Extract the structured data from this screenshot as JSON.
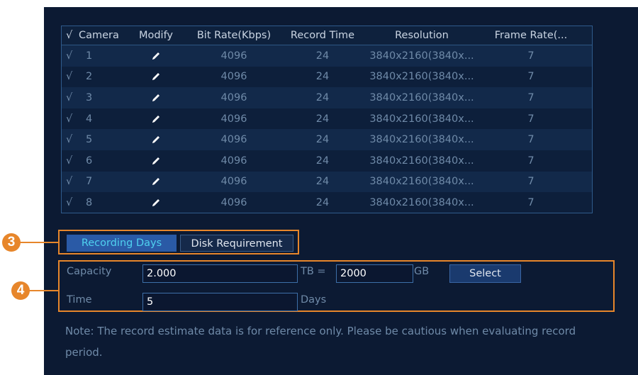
{
  "table": {
    "headers": {
      "check": "√",
      "camera": "Camera",
      "modify": "Modify",
      "bitrate": "Bit Rate(Kbps)",
      "record_time": "Record Time",
      "resolution": "Resolution",
      "frame_rate": "Frame Rate(..."
    },
    "rows": [
      {
        "check": "√",
        "camera": "1",
        "bitrate": "4096",
        "record_time": "24",
        "resolution": "3840x2160(3840x...",
        "frame_rate": "7"
      },
      {
        "check": "√",
        "camera": "2",
        "bitrate": "4096",
        "record_time": "24",
        "resolution": "3840x2160(3840x...",
        "frame_rate": "7"
      },
      {
        "check": "√",
        "camera": "3",
        "bitrate": "4096",
        "record_time": "24",
        "resolution": "3840x2160(3840x...",
        "frame_rate": "7"
      },
      {
        "check": "√",
        "camera": "4",
        "bitrate": "4096",
        "record_time": "24",
        "resolution": "3840x2160(3840x...",
        "frame_rate": "7"
      },
      {
        "check": "√",
        "camera": "5",
        "bitrate": "4096",
        "record_time": "24",
        "resolution": "3840x2160(3840x...",
        "frame_rate": "7"
      },
      {
        "check": "√",
        "camera": "6",
        "bitrate": "4096",
        "record_time": "24",
        "resolution": "3840x2160(3840x...",
        "frame_rate": "7"
      },
      {
        "check": "√",
        "camera": "7",
        "bitrate": "4096",
        "record_time": "24",
        "resolution": "3840x2160(3840x...",
        "frame_rate": "7"
      },
      {
        "check": "√",
        "camera": "8",
        "bitrate": "4096",
        "record_time": "24",
        "resolution": "3840x2160(3840x...",
        "frame_rate": "7"
      }
    ],
    "modify_icon": "pencil-icon"
  },
  "tabs": {
    "recording_days": "Recording Days",
    "disk_requirement": "Disk Requirement",
    "active": "recording_days"
  },
  "form": {
    "capacity_label": "Capacity",
    "capacity_value": "2.000",
    "tb_label": "TB =",
    "gb_value": "2000",
    "gb_label": "GB",
    "select_label": "Select",
    "time_label": "Time",
    "time_value": "5",
    "days_label": "Days"
  },
  "note": "Note: The record estimate data is for reference only. Please be cautious when evaluating record period.",
  "callouts": {
    "tabs": "3",
    "form": "4"
  },
  "colors": {
    "background": "#0c1a33",
    "accent": "#e7862b",
    "active_tab": "#2a5aa6",
    "active_tab_text": "#4fd1ef"
  }
}
